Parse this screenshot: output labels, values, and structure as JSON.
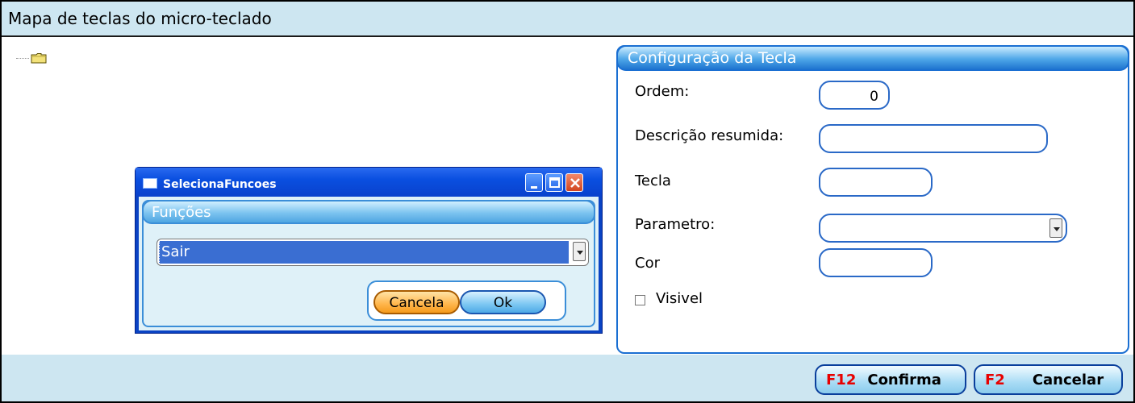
{
  "window": {
    "title": "Mapa de teclas do micro-teclado"
  },
  "tree": {
    "folder_icon": "folder-icon"
  },
  "config_panel": {
    "title": "Configuração da Tecla",
    "fields": {
      "ordem_label": "Ordem:",
      "ordem_value": "0",
      "descricao_label": "Descrição resumida:",
      "descricao_value": "",
      "tecla_label": "Tecla",
      "tecla_value": "",
      "parametro_label": "Parametro:",
      "parametro_value": "",
      "cor_label": "Cor",
      "cor_value": "",
      "visivel_label": "Visivel",
      "visivel_checked": false
    }
  },
  "dialog": {
    "title": "SelecionaFuncoes",
    "group_title": "Funções",
    "selected_function": "Sair",
    "cancel_label": "Cancela",
    "ok_label": "Ok"
  },
  "footer": {
    "confirm_key": "F12",
    "confirm_label": "Confirma",
    "cancel_key": "F2",
    "cancel_label": "Cancelar"
  },
  "colors": {
    "titlebar_bg": "#cde6f1",
    "panel_border": "#1a6fd2",
    "dialog_blue": "#0a43c4",
    "selection_blue": "#3a6ed2",
    "fkey_red": "#e80000",
    "cancel_orange": "#f59a1c"
  }
}
